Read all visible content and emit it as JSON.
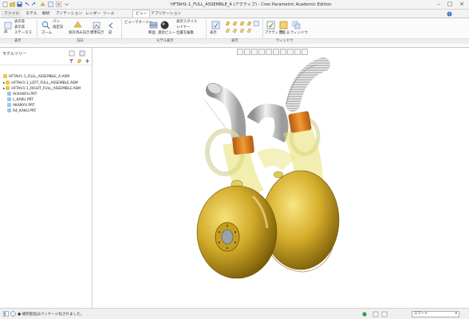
{
  "window": {
    "title": "HFTAH1-1_FULL_ASSEMBLE_A (アクティブ) - Creo Parametric Academic Edition"
  },
  "tabs": [
    "ファイル",
    "モデル",
    "解析",
    "アノテーション",
    "レンダー",
    "ツール",
    "ビュー",
    "アプリケーション"
  ],
  "active_tab": "ビュー",
  "ribbon": {
    "items": {
      "regenerate": "再",
      "display_hidden": "表示非",
      "display_hidden2": "表示非",
      "status": "ステータス",
      "view_state": "外観",
      "zoom": "ズーム",
      "pan": "パン",
      "reorient": "再定向",
      "saved_orientations": "保存済み向き",
      "standard_orientation": "標準向き",
      "previous": "前",
      "view_manager": "ビューマネージャ",
      "section": "断面",
      "perspective": "遠近ビュー",
      "display_style": "表示スタイル",
      "appearance": "外観ギャラリー",
      "layers": "レイヤー",
      "edit_position": "位置を編集",
      "edit_appearance": "配置を編集",
      "show": "表示",
      "activate": "アクティブ化",
      "close": "閉じる",
      "windows": "ウィンドウ"
    },
    "groups": {
      "display": "表示",
      "orientation": "方向",
      "model_display": "モデル表示",
      "show": "表示",
      "window": "ウィンドウ"
    }
  },
  "model_tree": {
    "title": "モデルツリー",
    "items": [
      {
        "label": "HFTAH1-1_FULL_ASSEMBLE_A.ASM",
        "kind": "asm"
      },
      {
        "label": "HFTAH1-1_LEFT_FULL_ASSEMBLE.ASM",
        "kind": "asm"
      },
      {
        "label": "HFTAH1-1_RIGHT_FULL_ASSEMBLE.ASM",
        "kind": "asm"
      },
      {
        "label": "ACKANYU.PRT",
        "kind": "prt"
      },
      {
        "label": "L_KAKU.PRT",
        "kind": "prt"
      },
      {
        "label": "AKANYU.PRT",
        "kind": "prt"
      },
      {
        "label": "R4_KAKU.PRT",
        "kind": "prt"
      }
    ]
  },
  "status": {
    "message": "● 補完部品はパッケージ化されました。",
    "filter": "スマート"
  },
  "colors": {
    "gold": "#c9a21a",
    "orange": "#e08a20",
    "accent": "#2a6fb8"
  }
}
